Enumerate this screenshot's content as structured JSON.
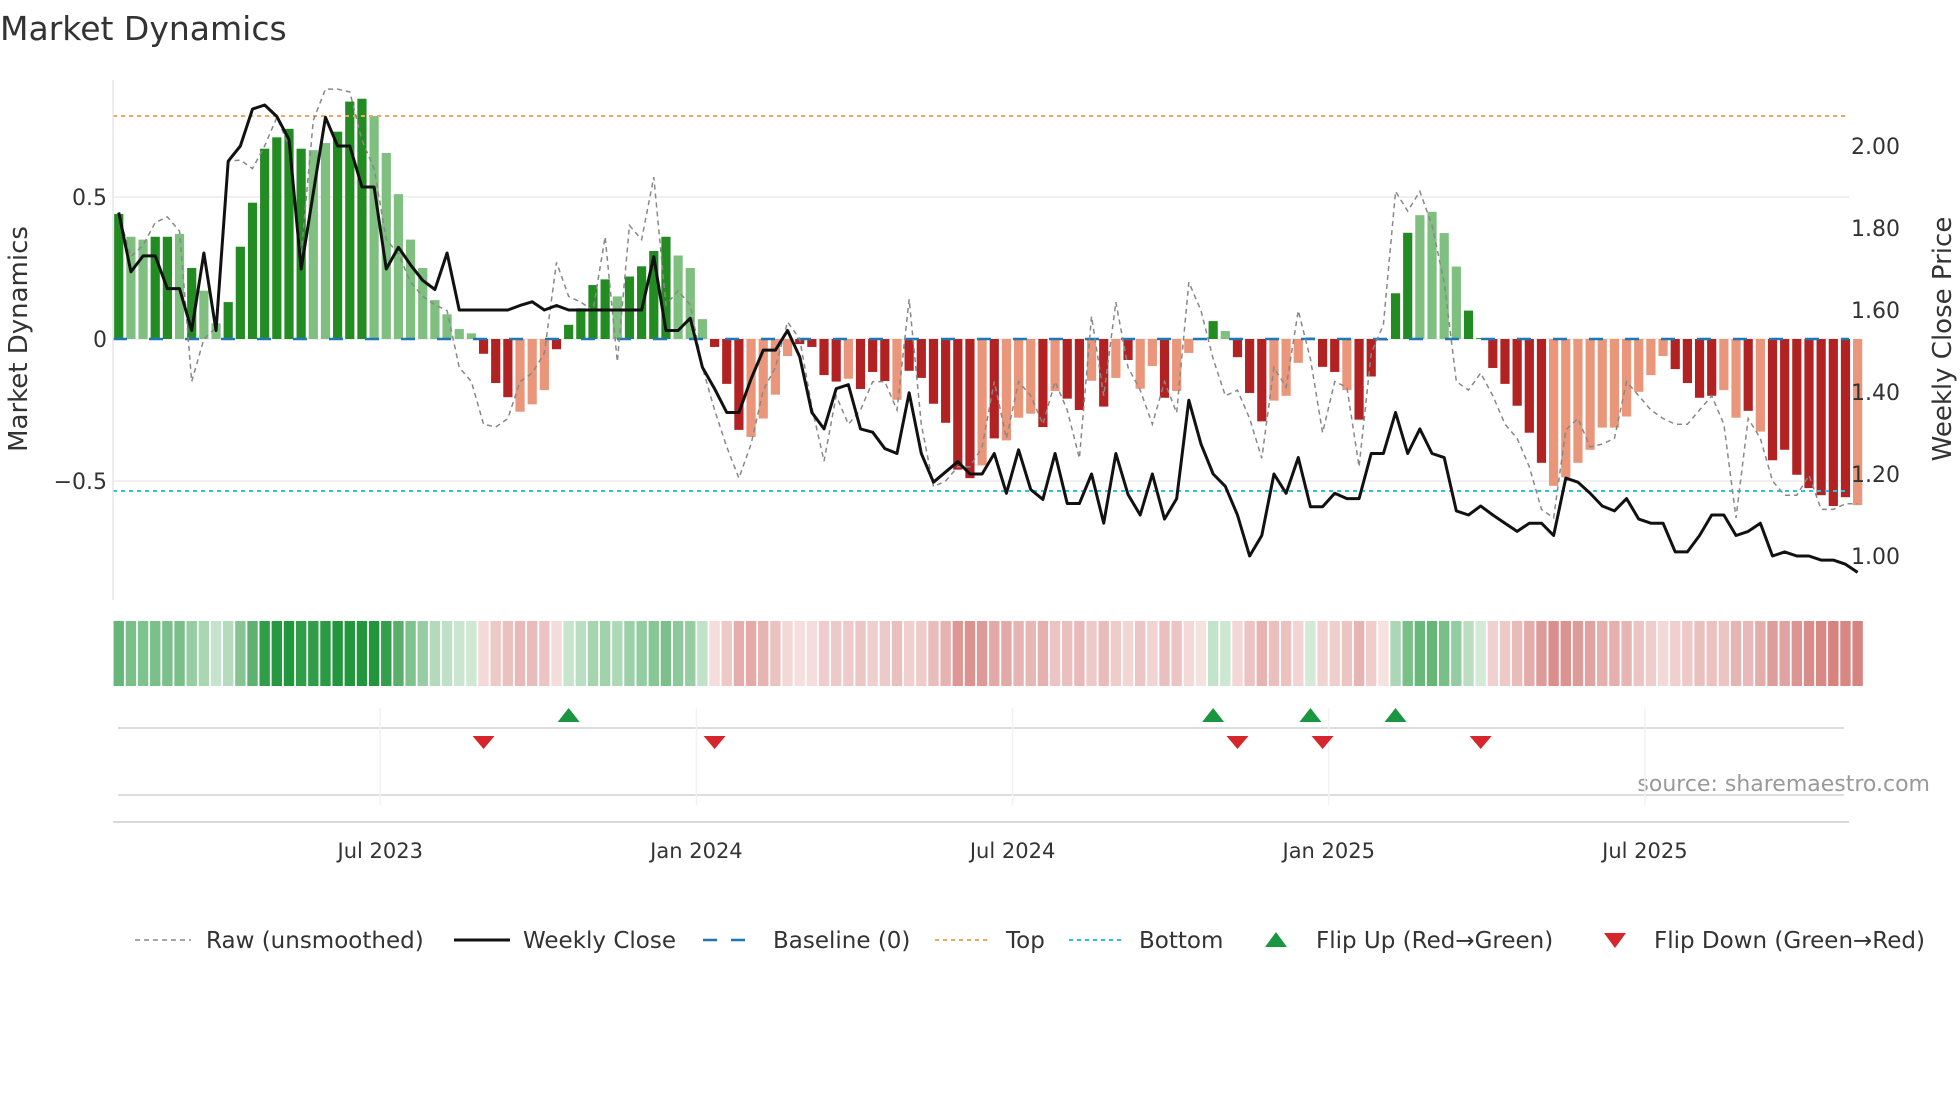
{
  "chart_data": {
    "type": "bar",
    "title": "Market Dynamics",
    "ylabel_left": "Market Dynamics",
    "ylabel_right": "Weekly Close Price",
    "left_ticks": [
      {
        "v": 0.5,
        "label": "0.5"
      },
      {
        "v": 0,
        "label": "0"
      },
      {
        "v": -0.5,
        "label": "−0.5"
      }
    ],
    "right_ticks": [
      {
        "v": 2.0,
        "label": "2.00"
      },
      {
        "v": 1.8,
        "label": "1.80"
      },
      {
        "v": 1.6,
        "label": "1.60"
      },
      {
        "v": 1.4,
        "label": "1.40"
      },
      {
        "v": 1.2,
        "label": "1.20"
      },
      {
        "v": 1.0,
        "label": "1.00"
      }
    ],
    "x_ticks": [
      {
        "index": 22,
        "label": "Jul 2023"
      },
      {
        "index": 48,
        "label": "Jan 2024"
      },
      {
        "index": 74,
        "label": "Jul 2024"
      },
      {
        "index": 100,
        "label": "Jan 2025"
      },
      {
        "index": 126,
        "label": "Jul 2025"
      }
    ],
    "ylim_left": [
      -0.92,
      0.92
    ],
    "ylim_right": [
      0.893,
      2.16
    ],
    "top_level": 0.785,
    "bottom_level": -0.535,
    "baseline": 0,
    "source": "source: sharemaestro.com",
    "colors": {
      "dark_green": "#228b22",
      "light_green": "#7fbf7f",
      "dark_red": "#b22222",
      "light_red": "#e9967a",
      "top": "#f4a460",
      "bottom": "#2bc4d6",
      "baseline": "#1f77b4",
      "close": "#111111",
      "raw": "#888888",
      "flip_up": "#1a9641",
      "flip_down": "#d7262b"
    },
    "market_dynamics": [
      0.44,
      0.36,
      0.35,
      0.36,
      0.36,
      0.37,
      0.25,
      0.17,
      0.055,
      0.13,
      0.325,
      0.48,
      0.67,
      0.71,
      0.74,
      0.67,
      0.665,
      0.69,
      0.73,
      0.836,
      0.846,
      0.785,
      0.655,
      0.51,
      0.35,
      0.25,
      0.137,
      0.087,
      0.035,
      0.02,
      -0.052,
      -0.155,
      -0.205,
      -0.256,
      -0.23,
      -0.18,
      -0.036,
      0.05,
      0.108,
      0.19,
      0.21,
      0.15,
      0.22,
      0.256,
      0.31,
      0.36,
      0.294,
      0.25,
      0.07,
      -0.028,
      -0.158,
      -0.32,
      -0.345,
      -0.28,
      -0.196,
      -0.06,
      -0.018,
      -0.028,
      -0.127,
      -0.15,
      -0.14,
      -0.176,
      -0.116,
      -0.148,
      -0.214,
      -0.112,
      -0.137,
      -0.228,
      -0.295,
      -0.46,
      -0.49,
      -0.445,
      -0.35,
      -0.357,
      -0.277,
      -0.263,
      -0.31,
      -0.183,
      -0.21,
      -0.25,
      -0.147,
      -0.238,
      -0.137,
      -0.074,
      -0.175,
      -0.095,
      -0.207,
      -0.183,
      -0.049,
      -0.004,
      0.063,
      0.028,
      -0.064,
      -0.19,
      -0.29,
      -0.217,
      -0.2,
      -0.084,
      0.005,
      -0.098,
      -0.116,
      -0.18,
      -0.284,
      -0.132,
      -0.005,
      0.161,
      0.374,
      0.436,
      0.448,
      0.373,
      0.255,
      0.1,
      0.003,
      -0.102,
      -0.158,
      -0.235,
      -0.33,
      -0.436,
      -0.517,
      -0.487,
      -0.436,
      -0.39,
      -0.312,
      -0.312,
      -0.273,
      -0.186,
      -0.127,
      -0.06,
      -0.106,
      -0.155,
      -0.207,
      -0.2,
      -0.18,
      -0.277,
      -0.253,
      -0.326,
      -0.427,
      -0.39,
      -0.478,
      -0.525,
      -0.55,
      -0.588,
      -0.557,
      -0.585
    ],
    "shade": "dllddldlldddddddlldddllllllllldddllldddddlddddllldddllllddddldddlddddddldllldlddldldlldllldldddllldddldddddlllldddddddllllllllllddddlldldddddddld",
    "raw_unsmoothed": [
      0.44,
      0.29,
      0.33,
      0.41,
      0.43,
      0.38,
      -0.15,
      0.0,
      0.04,
      0.626,
      0.63,
      0.6,
      0.68,
      0.78,
      0.68,
      0.3,
      0.77,
      0.88,
      0.88,
      0.87,
      0.7,
      0.6,
      0.35,
      0.3,
      0.2,
      0.15,
      0.12,
      0.1,
      -0.1,
      -0.15,
      -0.3,
      -0.31,
      -0.28,
      -0.15,
      -0.12,
      -0.05,
      0.27,
      0.15,
      0.13,
      0.1,
      0.36,
      -0.08,
      0.4,
      0.35,
      0.57,
      0.12,
      0.17,
      0.12,
      -0.1,
      -0.25,
      -0.38,
      -0.49,
      -0.37,
      -0.18,
      -0.1,
      0.06,
      0.0,
      -0.24,
      -0.43,
      -0.2,
      -0.3,
      -0.25,
      -0.15,
      -0.15,
      -0.25,
      0.14,
      -0.3,
      -0.52,
      -0.5,
      -0.45,
      -0.45,
      -0.38,
      -0.15,
      -0.35,
      -0.15,
      -0.2,
      -0.3,
      -0.15,
      -0.25,
      -0.42,
      0.08,
      -0.2,
      0.13,
      -0.1,
      -0.18,
      -0.3,
      -0.15,
      -0.26,
      0.2,
      0.1,
      -0.07,
      -0.2,
      -0.18,
      -0.28,
      -0.42,
      -0.1,
      -0.17,
      0.1,
      -0.07,
      -0.33,
      -0.15,
      -0.17,
      -0.45,
      -0.05,
      0.05,
      0.52,
      0.45,
      0.52,
      0.4,
      0.2,
      -0.15,
      -0.18,
      -0.12,
      -0.2,
      -0.3,
      -0.35,
      -0.45,
      -0.6,
      -0.63,
      -0.32,
      -0.28,
      -0.38,
      -0.37,
      -0.35,
      -0.15,
      -0.2,
      -0.25,
      -0.28,
      -0.3,
      -0.3,
      -0.25,
      -0.2,
      -0.3,
      -0.63,
      -0.28,
      -0.35,
      -0.5,
      -0.55,
      -0.55,
      -0.48,
      -0.6,
      -0.6,
      -0.58,
      -0.58
    ],
    "weekly_close": [
      1.838,
      1.693,
      1.732,
      1.732,
      1.652,
      1.652,
      1.55,
      1.739,
      1.55,
      1.963,
      2.0,
      2.09,
      2.1,
      2.072,
      2.016,
      1.7,
      1.886,
      2.07,
      2.0,
      2.0,
      1.9,
      1.9,
      1.7,
      1.753,
      1.71,
      1.672,
      1.65,
      1.739,
      1.6,
      1.6,
      1.6,
      1.6,
      1.6,
      1.611,
      1.62,
      1.6,
      1.611,
      1.6,
      1.6,
      1.6,
      1.6,
      1.6,
      1.6,
      1.6,
      1.73,
      1.55,
      1.55,
      1.58,
      1.46,
      1.408,
      1.35,
      1.35,
      1.432,
      1.502,
      1.502,
      1.55,
      1.486,
      1.35,
      1.31,
      1.408,
      1.418,
      1.31,
      1.302,
      1.262,
      1.25,
      1.398,
      1.25,
      1.18,
      1.205,
      1.23,
      1.2,
      1.2,
      1.25,
      1.153,
      1.259,
      1.162,
      1.138,
      1.25,
      1.128,
      1.128,
      1.2,
      1.08,
      1.25,
      1.15,
      1.1,
      1.2,
      1.09,
      1.14,
      1.38,
      1.273,
      1.2,
      1.17,
      1.1,
      1.0,
      1.05,
      1.2,
      1.153,
      1.24,
      1.12,
      1.12,
      1.153,
      1.14,
      1.14,
      1.25,
      1.25,
      1.35,
      1.25,
      1.31,
      1.25,
      1.24,
      1.11,
      1.1,
      1.122,
      1.1,
      1.08,
      1.06,
      1.08,
      1.08,
      1.05,
      1.19,
      1.18,
      1.153,
      1.122,
      1.11,
      1.14,
      1.09,
      1.08,
      1.08,
      1.01,
      1.01,
      1.05,
      1.1,
      1.1,
      1.05,
      1.06,
      1.08,
      1.0,
      1.01,
      1.0,
      1.0,
      0.99,
      0.99,
      0.98,
      0.96
    ],
    "flip_up_indices": [
      37,
      90,
      98,
      105
    ],
    "flip_down_indices": [
      30,
      49,
      92,
      99,
      112
    ],
    "legend": [
      {
        "key": "raw",
        "label": "Raw (unsmoothed)"
      },
      {
        "key": "close",
        "label": "Weekly Close"
      },
      {
        "key": "baseline",
        "label": "Baseline (0)"
      },
      {
        "key": "top",
        "label": "Top"
      },
      {
        "key": "bottom",
        "label": "Bottom"
      },
      {
        "key": "flip_up",
        "label": "Flip Up (Red→Green)"
      },
      {
        "key": "flip_down",
        "label": "Flip Down (Green→Red)"
      }
    ]
  }
}
